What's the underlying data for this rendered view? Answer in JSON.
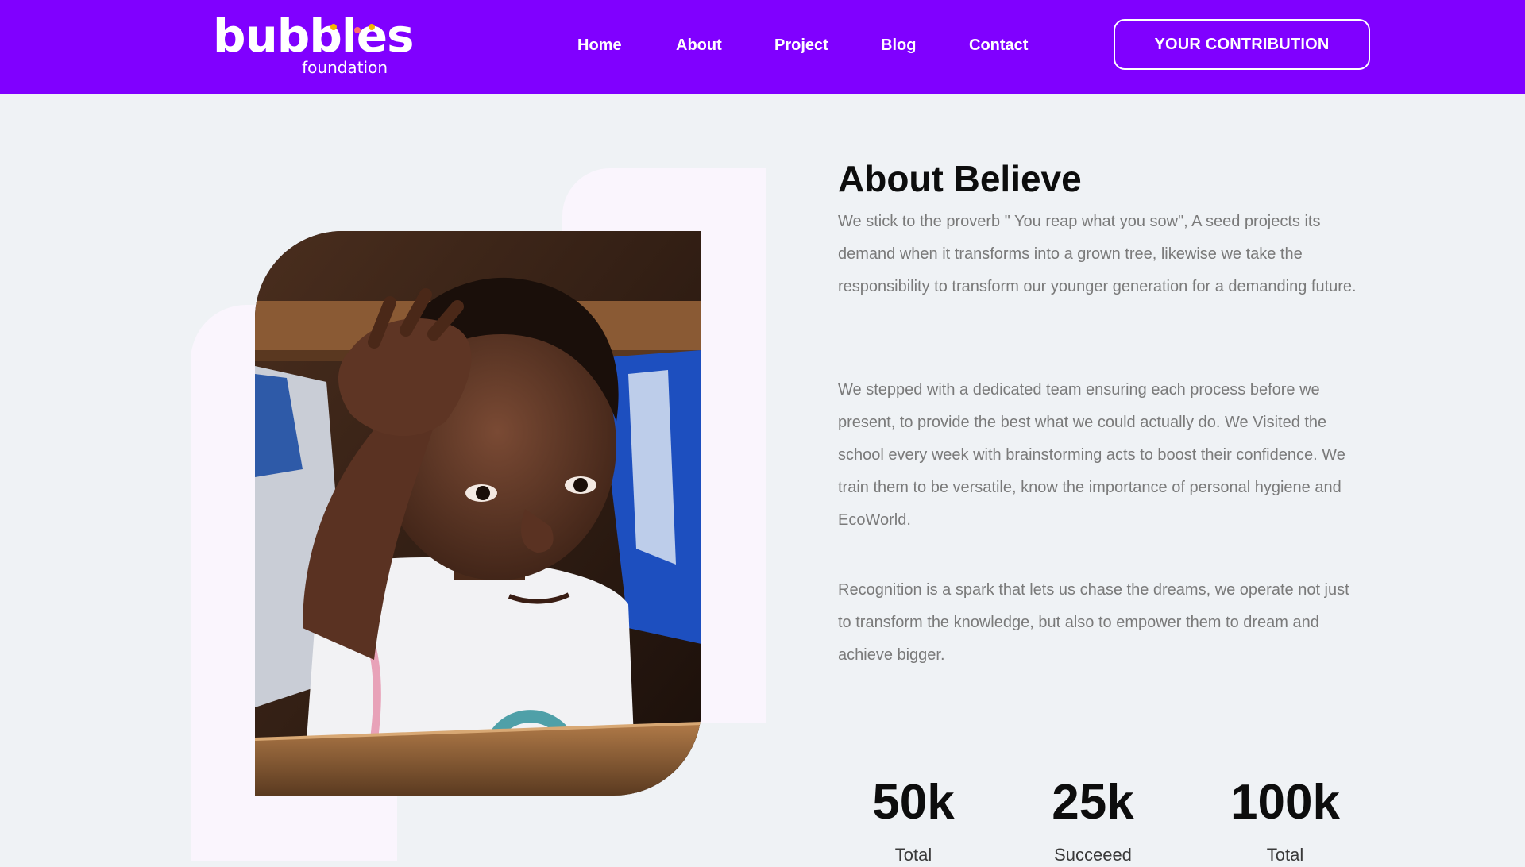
{
  "brand": {
    "name": "bubbles",
    "tagline": "foundation",
    "dot_colors": [
      "#f5b700",
      "#ff6b6b",
      "#f5b700"
    ]
  },
  "colors": {
    "accent": "#8000ff",
    "background": "#eff2f5",
    "heading": "#0d0d0d",
    "body_text": "#7a7a7a"
  },
  "nav": {
    "items": [
      {
        "label": "Home"
      },
      {
        "label": "About"
      },
      {
        "label": "Project"
      },
      {
        "label": "Blog"
      },
      {
        "label": "Contact"
      }
    ],
    "cta_label": "YOUR CONTRIBUTION"
  },
  "about": {
    "title": "About Believe",
    "paragraphs": [
      "We stick to the proverb \" You reap what you sow\", A seed projects its demand when it transforms into a grown tree, likewise we take the responsibility to transform our younger generation for a demanding future.",
      "We stepped with a dedicated team ensuring each process before we present, to provide the best what we could actually do. We Visited the school every week with brainstorming acts to boost their confidence. We train them to be versatile, know the importance of personal hygiene and EcoWorld.",
      "Recognition is a spark that lets us chase the dreams, we operate not just to transform the knowledge, but also to empower them to dream and achieve bigger."
    ],
    "image_description_icon": "child-photo"
  },
  "stats": [
    {
      "value": "50k",
      "label": "Total"
    },
    {
      "value": "25k",
      "label": "Succeeed"
    },
    {
      "value": "100k",
      "label": "Total"
    }
  ]
}
